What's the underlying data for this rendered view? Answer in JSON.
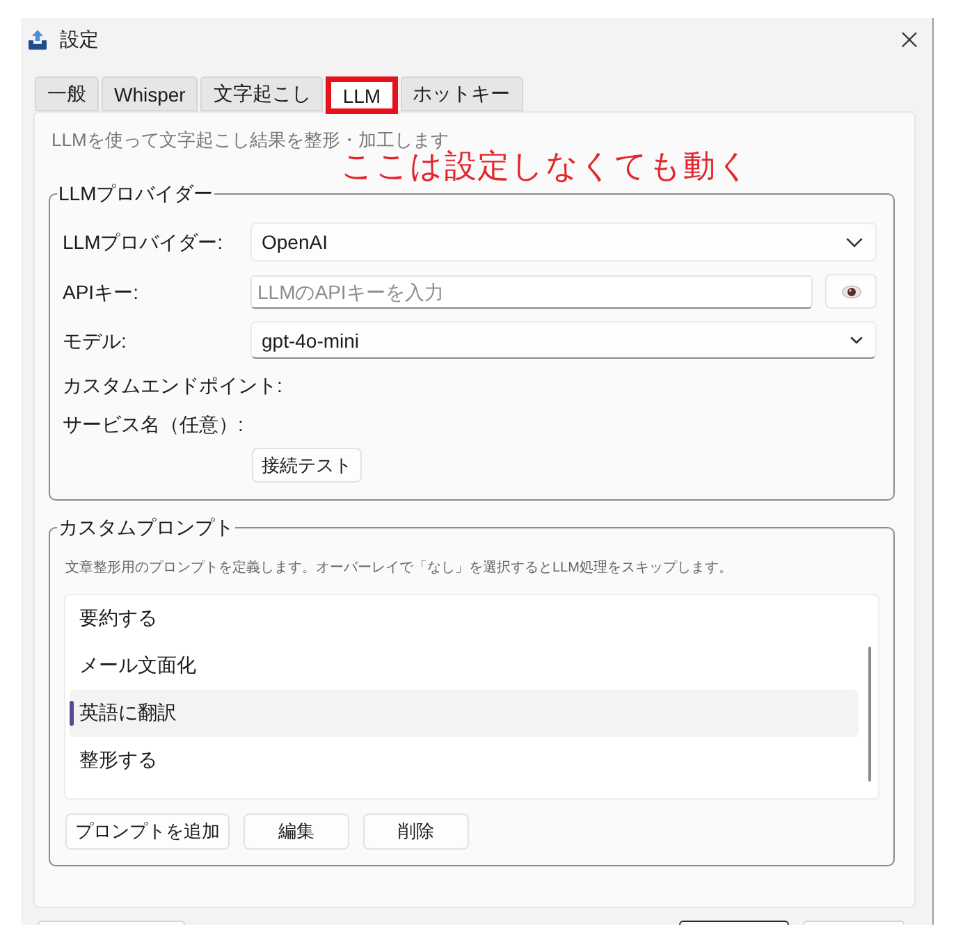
{
  "window": {
    "title": "設定"
  },
  "tabs": [
    {
      "label": "一般",
      "selected": false,
      "highlighted": false
    },
    {
      "label": "Whisper",
      "selected": false,
      "highlighted": false
    },
    {
      "label": "文字起こし",
      "selected": false,
      "highlighted": false
    },
    {
      "label": "LLM",
      "selected": true,
      "highlighted": true
    },
    {
      "label": "ホットキー",
      "selected": false,
      "highlighted": false
    }
  ],
  "panel": {
    "description": "LLMを使って文字起こし結果を整形・加工します",
    "annotation": "ここは設定しなくても動く"
  },
  "provider_group": {
    "title": "LLMプロバイダー",
    "fields": [
      {
        "kind": "dropdown",
        "label": "LLMプロバイダー:",
        "value": "OpenAI"
      },
      {
        "kind": "secret",
        "label": "APIキー:",
        "placeholder": "LLMのAPIキーを入力"
      },
      {
        "kind": "combo",
        "label": "モデル:",
        "value": "gpt-4o-mini"
      },
      {
        "kind": "label",
        "label": "カスタムエンドポイント:"
      },
      {
        "kind": "label",
        "label": "サービス名（任意）:"
      }
    ],
    "test_button": "接続テスト"
  },
  "prompt_group": {
    "title": "カスタムプロンプト",
    "description": "文章整形用のプロンプトを定義します。オーバーレイで「なし」を選択するとLLM処理をスキップします。",
    "prompts": [
      {
        "label": "要約する",
        "selected": false
      },
      {
        "label": "メール文面化",
        "selected": false
      },
      {
        "label": "英語に翻訳",
        "selected": true
      },
      {
        "label": "整形する",
        "selected": false
      }
    ],
    "buttons": [
      "プロンプトを追加",
      "編集",
      "削除"
    ]
  },
  "footer_buttons": [
    {
      "default": false
    },
    {
      "default": true
    },
    {
      "default": false
    }
  ]
}
